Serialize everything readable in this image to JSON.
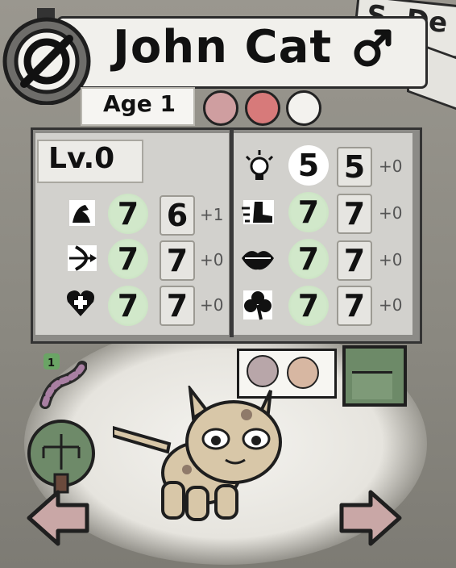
{
  "cat": {
    "name": "John Cat",
    "gender": "male",
    "age_label": "Age 1",
    "level_label": "Lv.0"
  },
  "moods": [
    {
      "icon": "neutral-heart-icon",
      "color": "#cf9ea0"
    },
    {
      "icon": "angry-face-icon",
      "color": "#d77a7a"
    },
    {
      "icon": "neutral-face-icon",
      "color": "#f3f2ee"
    }
  ],
  "stats_left": [
    {
      "icon": "strength-arm-icon",
      "base": "7",
      "current": "6",
      "bonus": "+1"
    },
    {
      "icon": "bow-arrow-icon",
      "base": "7",
      "current": "7",
      "bonus": "+0"
    },
    {
      "icon": "heart-plus-icon",
      "base": "7",
      "current": "7",
      "bonus": "+0"
    }
  ],
  "stats_right": [
    {
      "icon": "lightbulb-icon",
      "base": "5",
      "current": "5",
      "bonus": "+0"
    },
    {
      "icon": "boot-speed-icon",
      "base": "7",
      "current": "7",
      "bonus": "+0"
    },
    {
      "icon": "lips-icon",
      "base": "7",
      "current": "7",
      "bonus": "+0"
    },
    {
      "icon": "clover-icon",
      "base": "7",
      "current": "7",
      "bonus": "+0"
    }
  ],
  "inventory": {
    "candy_count": "1"
  },
  "background_sign": "S. De",
  "colors": {
    "green_value": "#d1e8ca",
    "pipe": "#6d8a68",
    "arrow": "#c9a7a6"
  }
}
